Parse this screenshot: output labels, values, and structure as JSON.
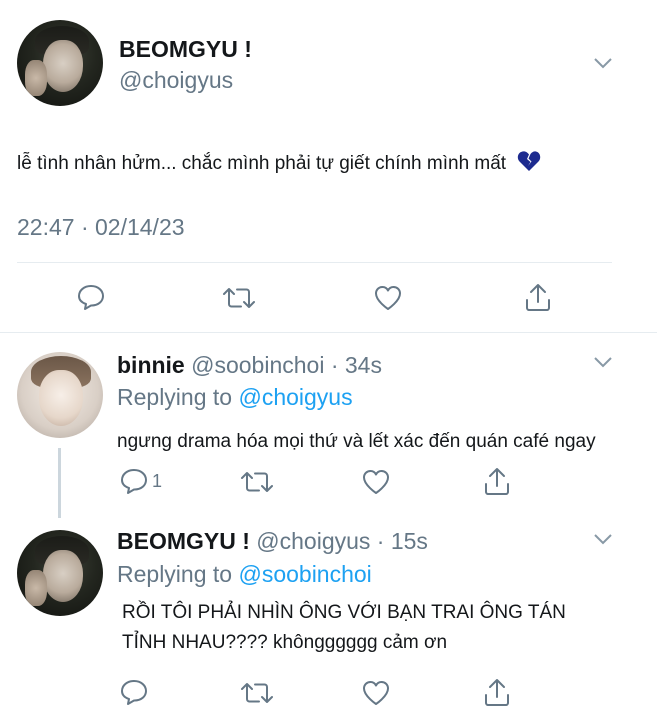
{
  "main_tweet": {
    "display_name": "BEOMGYU !",
    "handle": "@choigyus",
    "text": "lễ tình nhân hửm... chắc mình phải tự giết chính mình mất",
    "emoji": "💔",
    "timestamp": "22:47 · 02/14/23"
  },
  "reply1": {
    "display_name": "binnie",
    "handle_time": "@soobinchoi · 34s",
    "replying_prefix": "Replying to",
    "replying_to": "@choigyus",
    "text": "ngưng drama hóa mọi thứ và lết xác đến quán café ngay",
    "reply_count": "1"
  },
  "reply2": {
    "display_name": "BEOMGYU !",
    "handle_time": "@choigyus · 15s",
    "replying_prefix": "Replying to",
    "replying_to": "@soobinchoi",
    "text_line1": "RỒI TÔI PHẢI NHÌN ÔNG VỚI BẠN TRAI ÔNG TÁN",
    "text_line2": "TỈNH NHAU???? khôngggggg cảm ơn"
  },
  "icons": {
    "reply": "comment-icon",
    "retweet": "retweet-icon",
    "like": "heart-icon",
    "share": "share-icon",
    "more": "chevron-down-icon"
  },
  "colors": {
    "text": "#14171a",
    "secondary": "#657786",
    "link": "#1da1f2",
    "divider": "#e6ecf0",
    "heart_emoji": "#1d2b8f"
  }
}
